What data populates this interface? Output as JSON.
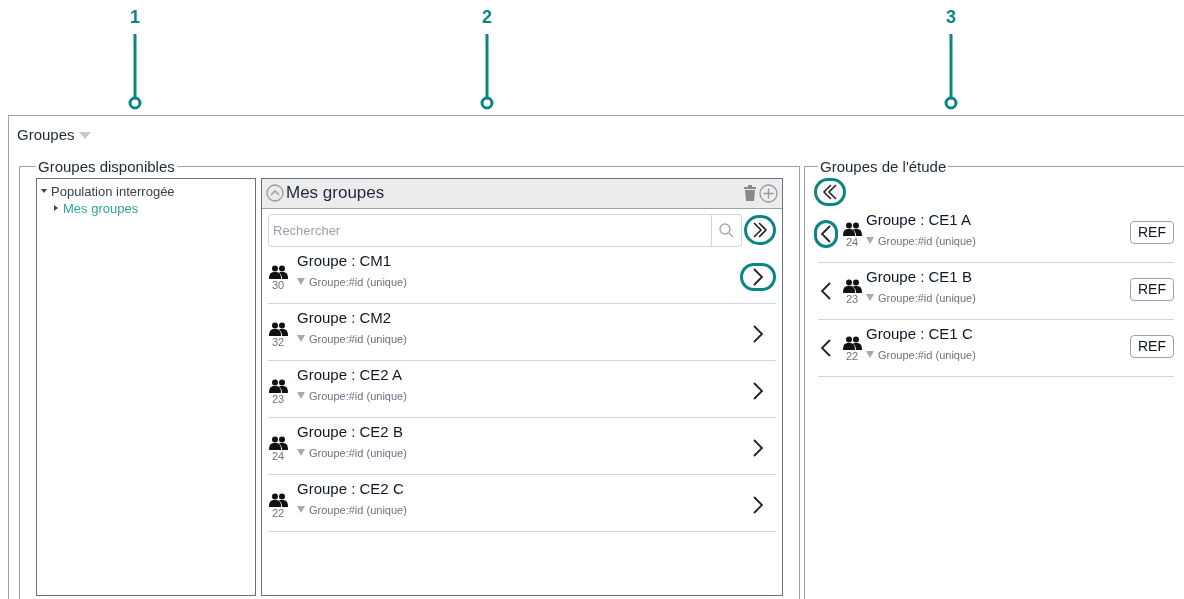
{
  "callouts": [
    {
      "label": "1"
    },
    {
      "label": "2"
    },
    {
      "label": "3"
    }
  ],
  "title": "Groupes",
  "available": {
    "legend": "Groupes disponibles",
    "tree": [
      {
        "label": "Population interrogée",
        "expanded": true,
        "selected": false,
        "children": [
          {
            "label": "Mes groupes",
            "expanded": false,
            "selected": true
          }
        ]
      }
    ],
    "panel": {
      "title": "Mes groupes",
      "search": {
        "placeholder": "Rechercher"
      },
      "add_all_highlighted": true,
      "groups": [
        {
          "name": "Groupe : CM1",
          "count": "30",
          "filter": "Groupe:#id (unique)",
          "highlighted": true
        },
        {
          "name": "Groupe : CM2",
          "count": "32",
          "filter": "Groupe:#id (unique)",
          "highlighted": false
        },
        {
          "name": "Groupe : CE2 A",
          "count": "23",
          "filter": "Groupe:#id (unique)",
          "highlighted": false
        },
        {
          "name": "Groupe : CE2 B",
          "count": "24",
          "filter": "Groupe:#id (unique)",
          "highlighted": false
        },
        {
          "name": "Groupe : CE2 C",
          "count": "22",
          "filter": "Groupe:#id (unique)",
          "highlighted": false
        }
      ]
    }
  },
  "study": {
    "legend": "Groupes de l'étude",
    "remove_all_highlighted": true,
    "groups": [
      {
        "name": "Groupe : CE1 A",
        "count": "24",
        "filter": "Groupe:#id (unique)",
        "highlighted": true,
        "button": "REF"
      },
      {
        "name": "Groupe : CE1 B",
        "count": "23",
        "filter": "Groupe:#id (unique)",
        "highlighted": false,
        "button": "REF"
      },
      {
        "name": "Groupe : CE1 C",
        "count": "22",
        "filter": "Groupe:#id (unique)",
        "highlighted": false,
        "button": "REF"
      }
    ]
  }
}
